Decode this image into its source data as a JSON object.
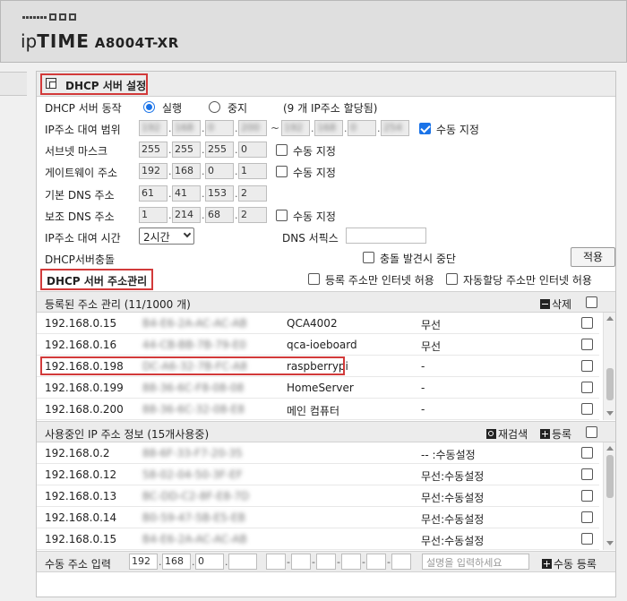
{
  "header": {
    "brand_ip": "ip",
    "brand_time": "TIME",
    "model": "A8004T-XR"
  },
  "dhcp": {
    "title": "DHCP 서버 설정",
    "server_op_label": "DHCP 서버 동작",
    "run_label": "실행",
    "stop_label": "중지",
    "ip_alloc_text": "(9 개 IP주소 할당됨)",
    "range_label": "IP주소 대여 범위",
    "range_start": [
      "192",
      "168",
      "0",
      "200"
    ],
    "range_end": [
      "192",
      "168",
      "0",
      "254"
    ],
    "range_dash": "~",
    "manual_label": "수동 지정",
    "subnet_label": "서브넷 마스크",
    "subnet": [
      "255",
      "255",
      "255",
      "0"
    ],
    "gateway_label": "게이트웨이 주소",
    "gateway": [
      "192",
      "168",
      "0",
      "1"
    ],
    "dns1_label": "기본 DNS 주소",
    "dns1": [
      "61",
      "41",
      "153",
      "2"
    ],
    "dns2_label": "보조 DNS 주소",
    "dns2": [
      "1",
      "214",
      "68",
      "2"
    ],
    "lease_label": "IP주소 대여 시간",
    "lease_value": "2시간",
    "dns_suffix_label": "DNS 서픽스",
    "conflict_label": "DHCP서버충돌",
    "conflict_stop_label": "충돌 발견시 중단",
    "apply_button": "적용"
  },
  "address_mgmt": {
    "title": "DHCP 서버 주소관리",
    "registered_only": "등록 주소만 인터넷 허용",
    "auto_only": "자동할당 주소만 인터넷 허용"
  },
  "registered": {
    "title": "등록된 주소 관리 (11/1000 개)",
    "delete_label": "삭제",
    "rows": [
      {
        "ip": "192.168.0.15",
        "mac": "B4-E6-2A-AC-AC-AB",
        "name": "QCA4002",
        "type": "무선"
      },
      {
        "ip": "192.168.0.16",
        "mac": "44-CB-BB-7B-79-E0",
        "name": "qca-ioeboard",
        "type": "무선"
      },
      {
        "ip": "192.168.0.198",
        "mac": "DC-A6-32-7B-FC-A8",
        "name": "raspberrypi",
        "type": "-"
      },
      {
        "ip": "192.168.0.199",
        "mac": "88-36-6C-F8-08-08",
        "name": "HomeServer",
        "type": "-"
      },
      {
        "ip": "192.168.0.200",
        "mac": "88-36-6C-32-08-E8",
        "name": "메인 컴퓨터",
        "type": "-"
      }
    ]
  },
  "in_use": {
    "title": "사용중인 IP 주소 정보 (15개사용중)",
    "rescan_label": "재검색",
    "register_label": "등록",
    "rows": [
      {
        "ip": "192.168.0.2",
        "mac": "88-6F-33-F7-20-35",
        "status": "-- :수동설정"
      },
      {
        "ip": "192.168.0.12",
        "mac": "58-02-04-50-3F-EF",
        "status": "무선:수동설정"
      },
      {
        "ip": "192.168.0.13",
        "mac": "BC-DD-C2-8F-E8-7D",
        "status": "무선:수동설정"
      },
      {
        "ip": "192.168.0.14",
        "mac": "B0-59-47-5B-E5-EB",
        "status": "무선:수동설정"
      },
      {
        "ip": "192.168.0.15",
        "mac": "B4-E6-2A-AC-AC-AB",
        "status": "무선:수동설정"
      }
    ]
  },
  "manual_entry": {
    "label": "수동 주소 입력",
    "ip": [
      "192",
      "168",
      "0",
      ""
    ],
    "desc_placeholder": "설명을 입력하세요",
    "register_label": "수동 등록"
  }
}
